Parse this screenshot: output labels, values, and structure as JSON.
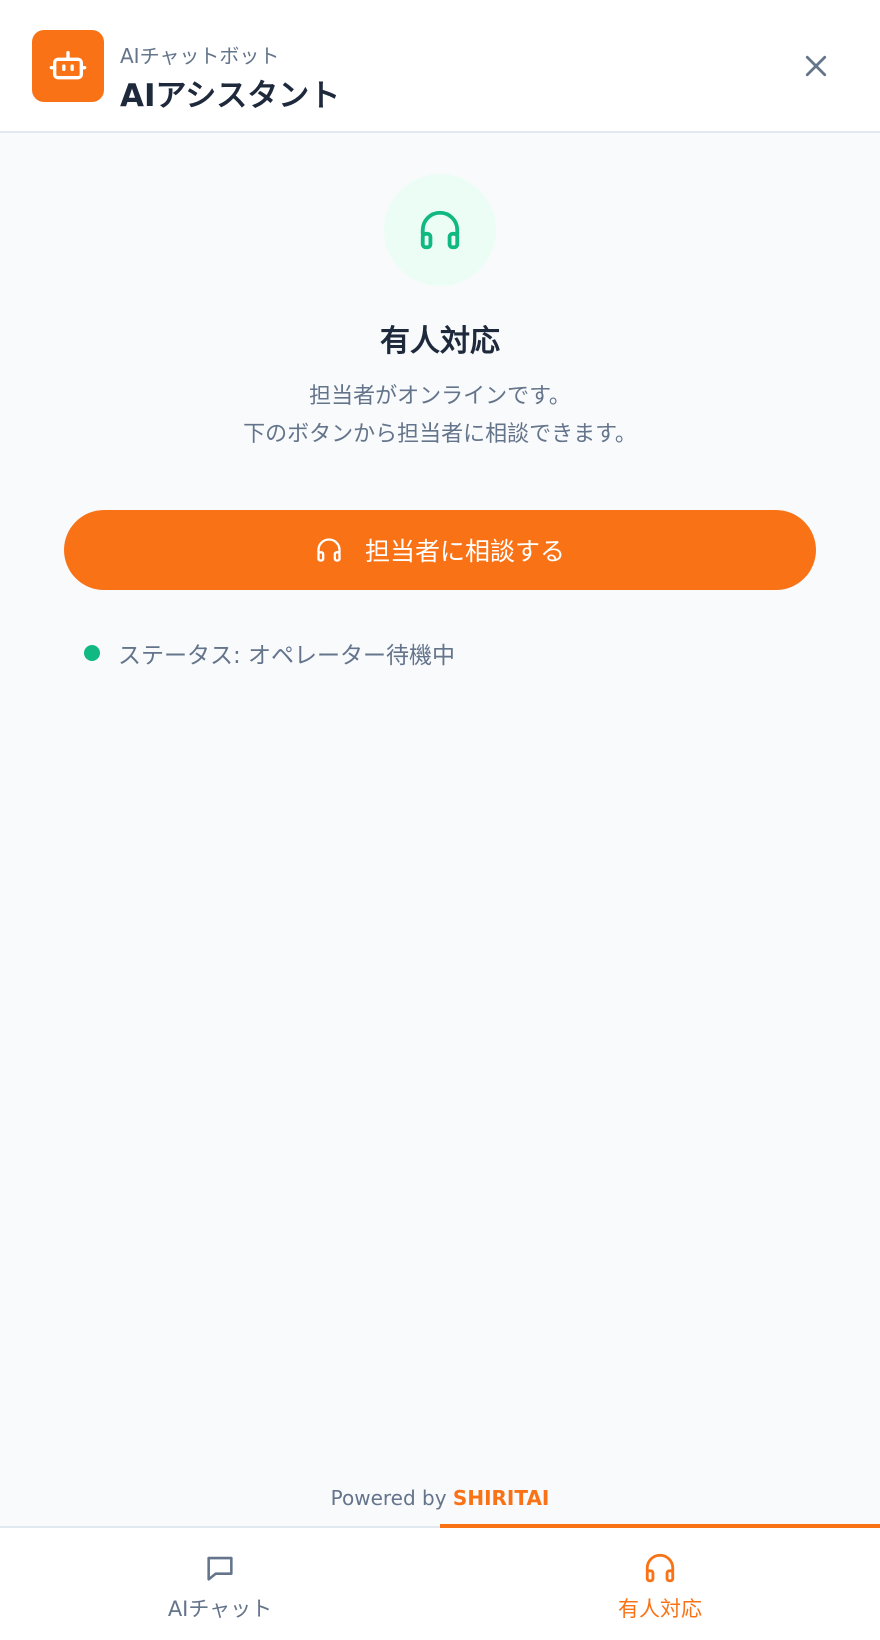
{
  "header": {
    "subtitle": "AIチャットボット",
    "title": "AIアシスタント",
    "logo_icon": "robot-icon",
    "close_icon": "close-icon"
  },
  "main": {
    "hero_icon": "headset-icon",
    "title": "有人対応",
    "description_line1": "担当者がオンラインです。",
    "description_line2": "下のボタンから担当者に相談できます。",
    "cta_label": "担当者に相談する",
    "status_text": "ステータス: オペレーター待機中"
  },
  "footer": {
    "powered_prefix": "Powered by",
    "powered_brand": "SHIRITAI"
  },
  "tabs": [
    {
      "label": "AIチャット",
      "icon": "chat-icon",
      "active": false
    },
    {
      "label": "有人対応",
      "icon": "headset-icon",
      "active": true
    }
  ],
  "colors": {
    "accent": "#f97316",
    "online": "#10b981",
    "hero_bg": "#ecfdf5"
  }
}
